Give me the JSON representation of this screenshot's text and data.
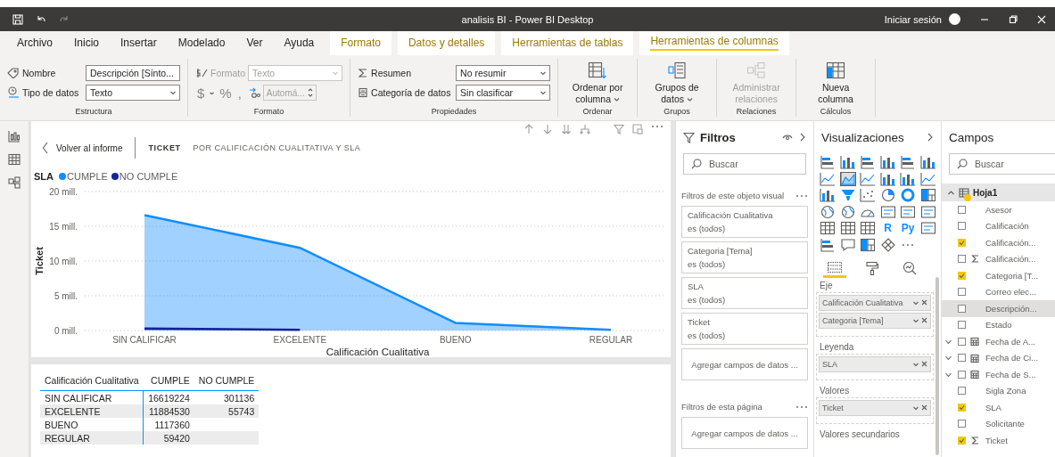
{
  "window": {
    "title": "analisis BI - Power BI Desktop",
    "sign_in": "Iniciar sesión"
  },
  "tabs": [
    {
      "label": "Archivo",
      "kind": "normal",
      "selected": false
    },
    {
      "label": "Inicio",
      "kind": "normal",
      "selected": false
    },
    {
      "label": "Insertar",
      "kind": "normal",
      "selected": false
    },
    {
      "label": "Modelado",
      "kind": "normal",
      "selected": false
    },
    {
      "label": "Ver",
      "kind": "normal",
      "selected": false
    },
    {
      "label": "Ayuda",
      "kind": "normal",
      "selected": false
    },
    {
      "label": "Formato",
      "kind": "contextual",
      "selected": false
    },
    {
      "label": "Datos y detalles",
      "kind": "contextual",
      "selected": false
    },
    {
      "label": "Herramientas de tablas",
      "kind": "contextual",
      "selected": false
    },
    {
      "label": "Herramientas de columnas",
      "kind": "contextual",
      "selected": true
    }
  ],
  "ribbon": {
    "estructura": {
      "label": "Estructura",
      "name_label": "Nombre",
      "name_value": "Descripción [Sínto...",
      "type_label": "Tipo de datos",
      "type_value": "Texto"
    },
    "formato": {
      "label": "Formato",
      "format_label": "Formato",
      "format_value": "Texto",
      "disabled": true,
      "symbols": [
        "$",
        "%",
        ","
      ],
      "decimals_value": "Automá..."
    },
    "propiedades": {
      "label": "Propiedades",
      "summary_label": "Resumen",
      "summary_value": "No resumir",
      "category_label": "Categoría de datos",
      "category_value": "Sin clasificar"
    },
    "buttons": [
      {
        "kind": "sort",
        "group": "Ordenar",
        "label": "Ordenar por columna",
        "menu": true,
        "disabled": false
      },
      {
        "kind": "groups",
        "group": "Grupos",
        "label": "Grupos de datos",
        "menu": true,
        "disabled": false
      },
      {
        "kind": "relations",
        "group": "Relaciones",
        "label": "Administrar relaciones",
        "menu": false,
        "disabled": true
      },
      {
        "kind": "column",
        "group": "Cálculos",
        "label": "Nueva columna",
        "menu": false,
        "disabled": false
      }
    ]
  },
  "visual": {
    "back_label": "Volver al informe",
    "title": "TICKET",
    "subtitle": "POR CALIFICACIÓN CUALITATIVA Y SLA",
    "legend_title": "SLA",
    "chart_data": {
      "type": "area",
      "xlabel": "Calificación Cualitativa",
      "ylabel": "Ticket",
      "categories": [
        "SIN CALIFICAR",
        "EXCELENTE",
        "BUENO",
        "REGULAR"
      ],
      "series": [
        {
          "name": "CUMPLE",
          "color": "#118dff",
          "values": [
            16.6,
            11.9,
            1.1,
            0.1
          ]
        },
        {
          "name": "NO CUMPLE",
          "color": "#12239e",
          "values": [
            0.3,
            0.1,
            null,
            null
          ]
        }
      ],
      "ylim": [
        0,
        20
      ],
      "grid": true,
      "yticks": [
        {
          "value": 0,
          "label": "0 mill."
        },
        {
          "value": 5,
          "label": "5 mill."
        },
        {
          "value": 10,
          "label": "10 mill."
        },
        {
          "value": 15,
          "label": "15 mill."
        },
        {
          "value": 20,
          "label": "20 mill."
        }
      ]
    }
  },
  "table": {
    "columns": [
      "Calificación Cualitativa",
      "CUMPLE",
      "NO CUMPLE"
    ],
    "rows": [
      [
        "SIN CALIFICAR",
        "16619224",
        "301136"
      ],
      [
        "EXCELENTE",
        "11884530",
        "55743"
      ],
      [
        "BUENO",
        "1117360"
      ],
      [
        "REGULAR",
        "59420"
      ]
    ]
  },
  "filters": {
    "title": "Filtros",
    "search_placeholder": "Buscar",
    "visual_section": "Filtros de este objeto visual",
    "cards": [
      {
        "name": "Calificación Cualitativa",
        "value": "es (todos)"
      },
      {
        "name": "Categoria [Tema]",
        "value": "es (todos)"
      },
      {
        "name": "SLA",
        "value": "es (todos)"
      },
      {
        "name": "Ticket",
        "value": "es (todos)"
      }
    ],
    "add_label": "Agregar campos de datos ...",
    "page_section": "Filtros de esta página",
    "page_add_label": "Agregar campos de datos ..."
  },
  "visualizations": {
    "title": "Visualizaciones",
    "icons": [
      {
        "kind": "bar",
        "selected": false
      },
      {
        "kind": "column",
        "selected": false
      },
      {
        "kind": "bar",
        "selected": false
      },
      {
        "kind": "column",
        "selected": false
      },
      {
        "kind": "bar",
        "selected": false
      },
      {
        "kind": "column",
        "selected": false
      },
      {
        "kind": "line",
        "selected": false
      },
      {
        "kind": "area",
        "selected": true
      },
      {
        "kind": "line",
        "selected": false
      },
      {
        "kind": "column",
        "selected": false
      },
      {
        "kind": "column",
        "selected": false
      },
      {
        "kind": "line",
        "selected": false
      },
      {
        "kind": "column",
        "selected": false
      },
      {
        "kind": "funnel",
        "selected": false
      },
      {
        "kind": "scatter",
        "selected": false
      },
      {
        "kind": "pie",
        "selected": false
      },
      {
        "kind": "donut",
        "selected": false
      },
      {
        "kind": "treemap",
        "selected": false
      },
      {
        "kind": "map",
        "selected": false
      },
      {
        "kind": "map",
        "selected": false
      },
      {
        "kind": "gauge",
        "selected": false
      },
      {
        "kind": "card",
        "selected": false
      },
      {
        "kind": "card",
        "selected": false
      },
      {
        "kind": "card",
        "selected": false
      },
      {
        "kind": "table",
        "selected": false
      },
      {
        "kind": "table",
        "selected": false
      },
      {
        "kind": "table",
        "selected": false
      },
      {
        "kind": "text",
        "label": "R",
        "selected": false
      },
      {
        "kind": "text",
        "label": "Py",
        "selected": false
      },
      {
        "kind": "card",
        "selected": false
      },
      {
        "kind": "bar",
        "selected": false
      },
      {
        "kind": "speech",
        "selected": false
      },
      {
        "kind": "treemap",
        "selected": false
      },
      {
        "kind": "diamond",
        "selected": false
      }
    ],
    "tabs": [
      {
        "kind": "fields",
        "selected": true
      },
      {
        "kind": "format",
        "selected": false
      },
      {
        "kind": "analytics",
        "selected": false
      }
    ],
    "wells": [
      {
        "label": "Eje",
        "items": [
          "Calificación Cualitativa",
          "Categoria [Tema]"
        ]
      },
      {
        "label": "Leyenda",
        "items": [
          "SLA"
        ]
      },
      {
        "label": "Valores",
        "items": [
          "Ticket"
        ]
      },
      {
        "label": "Valores secundarios"
      }
    ]
  },
  "fields": {
    "title": "Campos",
    "search_placeholder": "Buscar",
    "tables": [
      {
        "name": "Hoja1",
        "expanded": true,
        "checked": true,
        "children": [
          {
            "name": "Asesor",
            "kind": "field",
            "checked": false,
            "selected": false
          },
          {
            "name": "Calificación",
            "kind": "field",
            "checked": false,
            "selected": false
          },
          {
            "name": "Calificación...",
            "kind": "field",
            "checked": true,
            "selected": false
          },
          {
            "name": "Calificación...",
            "kind": "measure",
            "checked": false,
            "selected": false
          },
          {
            "name": "Categoria [T...",
            "kind": "field",
            "checked": true,
            "selected": false
          },
          {
            "name": "Correo elec...",
            "kind": "field",
            "checked": false,
            "selected": false
          },
          {
            "name": "Descripción...",
            "kind": "field",
            "checked": false,
            "selected": true
          },
          {
            "name": "Estado",
            "kind": "field",
            "checked": false,
            "selected": false
          },
          {
            "name": "Fecha de A...",
            "kind": "date",
            "checked": false,
            "selected": false,
            "expanded": false
          },
          {
            "name": "Fecha de Ci...",
            "kind": "date",
            "checked": false,
            "selected": false,
            "expanded": false
          },
          {
            "name": "Fecha de S...",
            "kind": "date",
            "checked": false,
            "selected": false,
            "expanded": false
          },
          {
            "name": "Sigla Zona",
            "kind": "field",
            "checked": false,
            "selected": false
          },
          {
            "name": "SLA",
            "kind": "field",
            "checked": true,
            "selected": false
          },
          {
            "name": "Solicitante",
            "kind": "field",
            "checked": false,
            "selected": false
          },
          {
            "name": "Ticket",
            "kind": "measure",
            "checked": true,
            "selected": false
          }
        ]
      }
    ]
  }
}
